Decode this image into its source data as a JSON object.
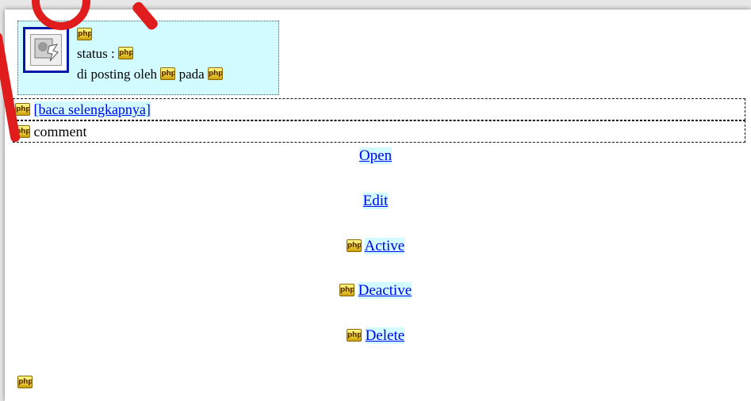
{
  "header": {
    "line1_icon": "php-icon",
    "status_label": "status :",
    "posted_by_label": "di posting oleh",
    "on_label": "pada"
  },
  "rows": {
    "read_more": "[baca selengkapnya]",
    "comment": "comment"
  },
  "actions": {
    "open": "Open",
    "edit": "Edit",
    "active": "Active",
    "deactive": "Deactive",
    "delete": "Delete"
  },
  "icons": {
    "php_placeholder": "php",
    "thumbnail": "broken-image-icon"
  },
  "colors": {
    "highlight": "#d2fbff",
    "link": "#0000ee",
    "thumb_border": "#0018a8",
    "decoration": "#e01c1c"
  }
}
